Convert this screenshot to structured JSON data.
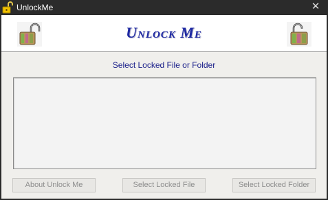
{
  "window": {
    "title": "UnlockMe",
    "close_glyph": "✕",
    "title_icon": "padlock-open-icon"
  },
  "banner": {
    "app_title": "Unlock Me",
    "left_icon": "padlock-open-icon",
    "right_icon": "padlock-open-icon"
  },
  "main": {
    "prompt": "Select Locked File or Folder"
  },
  "buttons": {
    "about_label": "About Unlock Me",
    "select_file_label": "Select Locked File",
    "select_folder_label": "Select Locked Folder"
  },
  "colors": {
    "title_blue": "#1f2aa3",
    "prompt_blue": "#1a1f8a",
    "titlebar_bg": "#2b2b2b",
    "client_bg": "#f0efec"
  }
}
